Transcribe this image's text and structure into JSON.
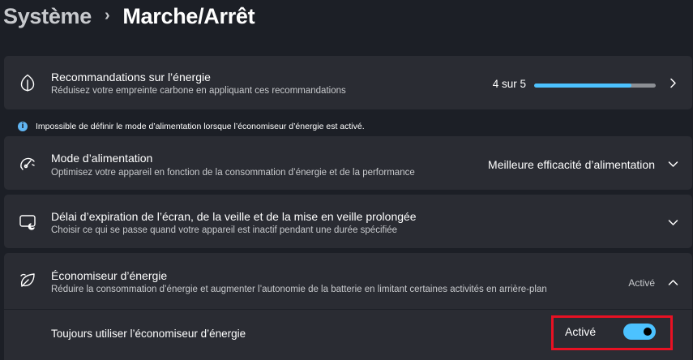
{
  "breadcrumb": {
    "parent": "Système",
    "separator": "›",
    "current": "Marche/Arrêt"
  },
  "energy_recommendations": {
    "title": "Recommandations sur l’énergie",
    "subtitle": "Réduisez votre empreinte carbone en appliquant ces recommandations",
    "progress_text": "4 sur 5",
    "progress_value": 0.8,
    "icon": "leaf-icon"
  },
  "info_message": {
    "text": "Impossible de définir le mode d’alimentation lorsque l’économiseur d’énergie est activé.",
    "icon": "info-icon"
  },
  "power_mode": {
    "title": "Mode d’alimentation",
    "subtitle": "Optimisez votre appareil en fonction de la consommation d’énergie et de la performance",
    "value": "Meilleure efficacité d’alimentation",
    "icon": "gauge-icon"
  },
  "screen_timeout": {
    "title": "Délai d’expiration de l’écran, de la veille et de la mise en veille prolongée",
    "subtitle": "Choisir ce qui se passe quand votre appareil est inactif pendant une durée spécifiée",
    "icon": "screen-sleep-icon"
  },
  "energy_saver": {
    "title": "Économiseur d’énergie",
    "subtitle": "Réduire la consommation d’énergie et augmenter l’autonomie de la batterie en limitant certaines activités en arrière-plan",
    "status": "Activé",
    "icon": "energy-saver-leaf-icon",
    "always_use": {
      "label": "Toujours utiliser l’économiseur d’énergie",
      "toggle_label": "Activé",
      "toggle_on": true
    }
  },
  "colors": {
    "accent": "#4cc2ff",
    "background": "#1c1f26",
    "card": "#2a2c33",
    "highlight": "#e81123"
  }
}
